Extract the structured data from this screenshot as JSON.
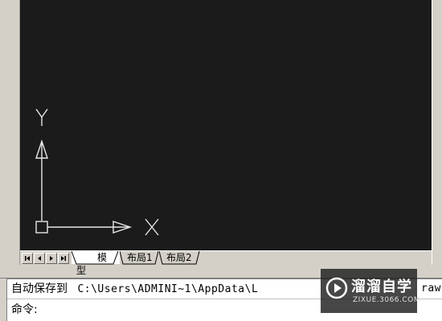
{
  "ucs": {
    "x_label": "X",
    "y_label": "Y",
    "axis_color": "#e8e8e8"
  },
  "drawing_area": {
    "background": "#1b1b1b"
  },
  "layout_tabs": [
    {
      "label": "模型",
      "active": true
    },
    {
      "label": "布局1",
      "active": false
    },
    {
      "label": "布局2",
      "active": false
    }
  ],
  "tab_nav": {
    "first_icon": "first-page-icon",
    "prev_icon": "previous-page-icon",
    "next_icon": "next-page-icon",
    "last_icon": "last-page-icon"
  },
  "command_window": {
    "history_label": "自动保存到",
    "history_path": "C:\\Users\\ADMINI~1\\AppData\\L",
    "history_path_tail": "rawi",
    "prompt": "命令:"
  },
  "watermark": {
    "title": "溜溜自学",
    "url": "ZIXUE.3066.COM",
    "icon": "play-logo-icon"
  }
}
